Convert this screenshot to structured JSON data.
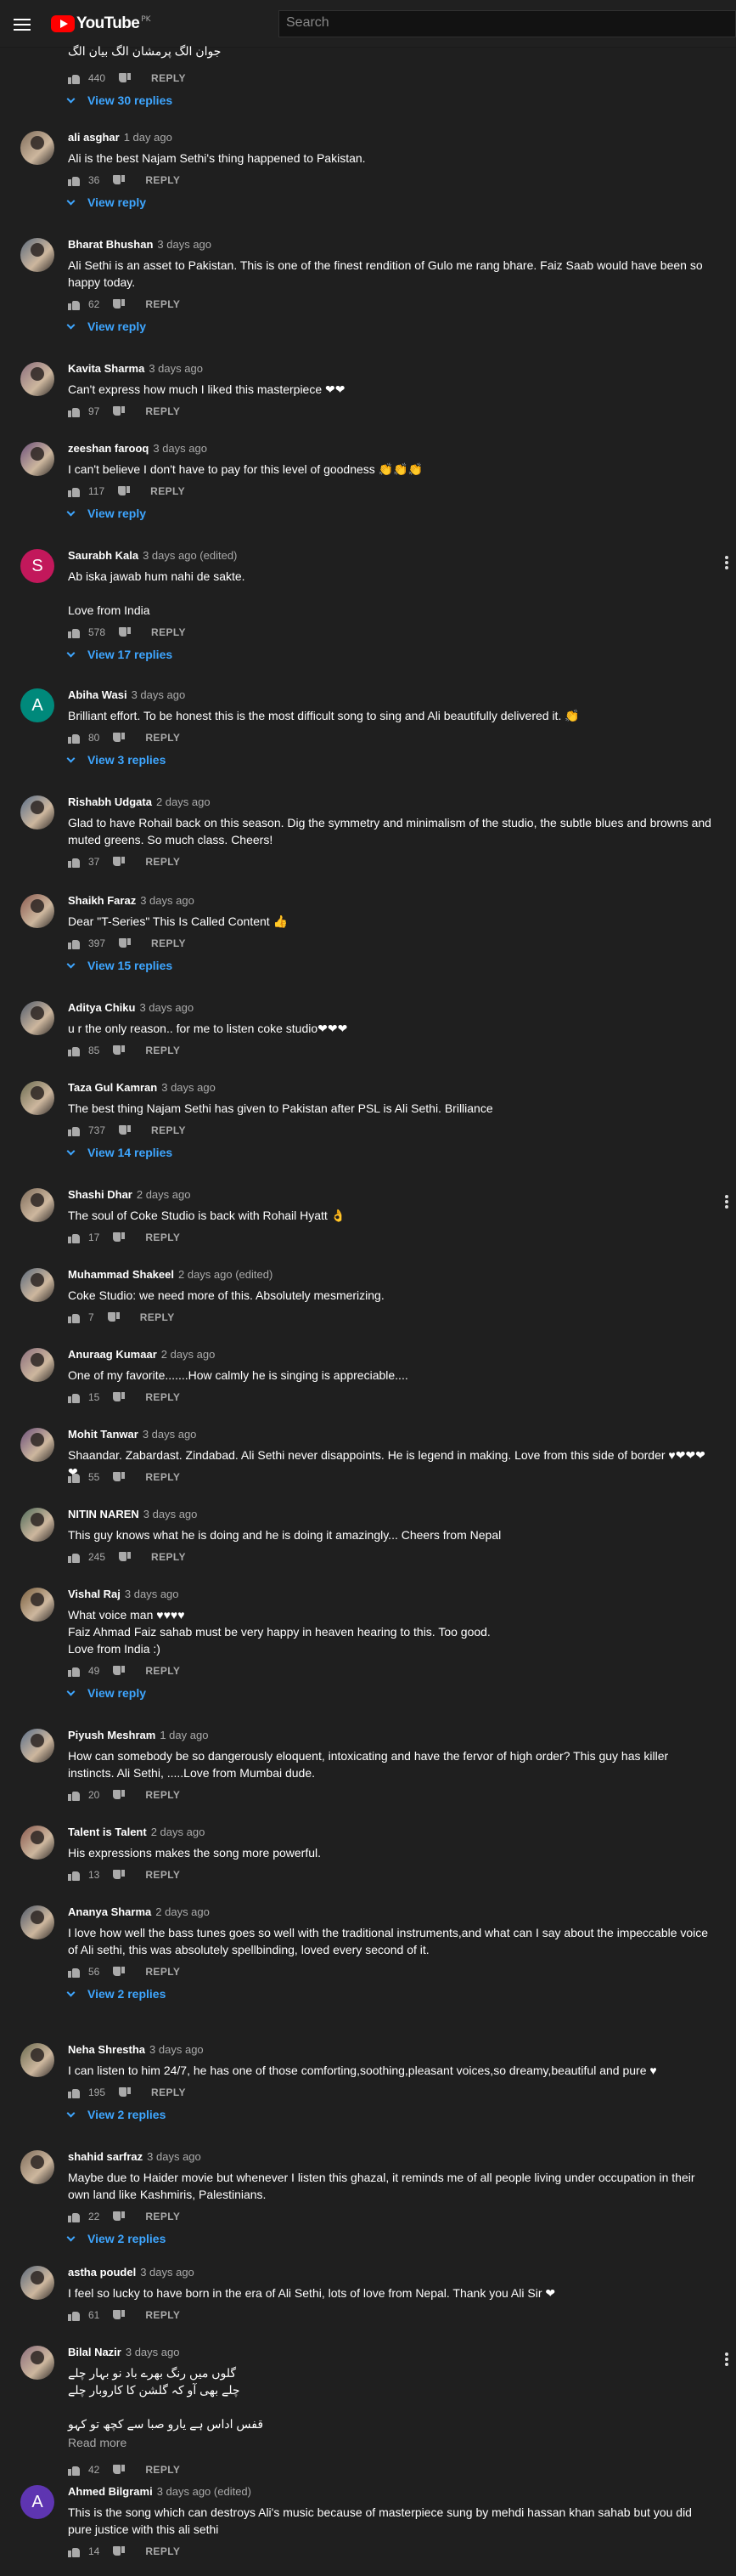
{
  "header": {
    "logo_text": "YouTube",
    "logo_region": "PK",
    "search_placeholder": "Search"
  },
  "top_partial": {
    "text": "جوان الگ پرمشان الگ بیان الگ",
    "likes": "440",
    "reply_label": "REPLY",
    "view_replies": "View 30 replies"
  },
  "comments": [
    {
      "name": "ali asghar",
      "date": "1 day ago",
      "text": "Ali is the best Najam Sethi's thing happened to Pakistan.",
      "likes": "36",
      "reply_label": "REPLY",
      "view_replies": "View reply"
    },
    {
      "name": "Bharat Bhushan",
      "date": "3 days ago",
      "text": "Ali Sethi is an asset to Pakistan. This is one of the finest rendition of Gulo me rang bhare. Faiz Saab would have been so happy today.",
      "likes": "62",
      "reply_label": "REPLY",
      "view_replies": "View reply"
    },
    {
      "name": "Kavita Sharma",
      "date": "3 days ago",
      "text": "Can't express how much I liked this masterpiece ❤❤",
      "likes": "97",
      "reply_label": "REPLY",
      "view_replies": ""
    },
    {
      "name": "zeeshan farooq",
      "date": "3 days ago",
      "text": "I can't believe I don't have to pay for this level of goodness 👏👏👏",
      "likes": "117",
      "reply_label": "REPLY",
      "view_replies": "View reply"
    },
    {
      "name": "Saurabh Kala",
      "date": "3 days ago (edited)",
      "text": "Ab iska jawab hum nahi de sakte.\n\nLove from India",
      "likes": "578",
      "reply_label": "REPLY",
      "view_replies": "View 17 replies",
      "avatar_letter": "S",
      "avatar_color": "#c2185b"
    },
    {
      "name": "Abiha Wasi",
      "date": "3 days ago",
      "text": "Brilliant effort. To be honest this is the most difficult song to sing and Ali beautifully delivered it. 👏",
      "likes": "80",
      "reply_label": "REPLY",
      "view_replies": "View 3 replies",
      "avatar_letter": "A",
      "avatar_color": "#00897b"
    },
    {
      "name": "Rishabh Udgata",
      "date": "2 days ago",
      "text": "Glad to have Rohail back on this season. Dig the symmetry and minimalism of the studio, the subtle blues and browns and muted greens. So much class. Cheers!",
      "likes": "37",
      "reply_label": "REPLY",
      "view_replies": ""
    },
    {
      "name": "Shaikh Faraz",
      "date": "3 days ago",
      "text": "Dear \"T-Series\" This Is Called Content 👍",
      "likes": "397",
      "reply_label": "REPLY",
      "view_replies": "View 15 replies"
    },
    {
      "name": "Aditya Chiku",
      "date": "3 days ago",
      "text": "u r the only reason..  for me to listen coke studio❤❤❤",
      "likes": "85",
      "reply_label": "REPLY",
      "view_replies": ""
    },
    {
      "name": "Taza Gul Kamran",
      "date": "3 days ago",
      "text": "The best thing Najam Sethi has given to Pakistan after PSL is Ali Sethi. Brilliance",
      "likes": "737",
      "reply_label": "REPLY",
      "view_replies": "View 14 replies"
    },
    {
      "name": "Shashi Dhar",
      "date": "2 days ago",
      "text": "The soul of Coke Studio is back with Rohail Hyatt 👌",
      "likes": "17",
      "reply_label": "REPLY",
      "view_replies": ""
    },
    {
      "name": "Muhammad Shakeel",
      "date": "2 days ago (edited)",
      "text": "Coke Studio: we need more of this. Absolutely mesmerizing.",
      "likes": "7",
      "reply_label": "REPLY",
      "view_replies": ""
    },
    {
      "name": "Anuraag Kumaar",
      "date": "2 days ago",
      "text": "One of my favorite.......How calmly he is singing is appreciable....",
      "likes": "15",
      "reply_label": "REPLY",
      "view_replies": ""
    },
    {
      "name": "Mohit Tanwar",
      "date": "3 days ago",
      "text": "Shaandar. Zabardast. Zindabad. Ali Sethi never disappoints. He is legend in making. Love from this side of border ♥❤❤❤❤",
      "likes": "55",
      "reply_label": "REPLY",
      "view_replies": ""
    },
    {
      "name": "NITIN NAREN",
      "date": "3 days ago",
      "text": "This guy knows what he is doing and he is doing it amazingly... Cheers from Nepal",
      "likes": "245",
      "reply_label": "REPLY",
      "view_replies": ""
    },
    {
      "name": "Vishal Raj",
      "date": "3 days ago",
      "text": "What voice man ♥♥♥♥\nFaiz Ahmad Faiz sahab must be very happy in heaven hearing to this. Too good.\nLove from India :)",
      "likes": "49",
      "reply_label": "REPLY",
      "view_replies": "View reply"
    },
    {
      "name": "Piyush Meshram",
      "date": "1 day ago",
      "text": "How can somebody be so dangerously eloquent, intoxicating and have the fervor of high order? This guy has killer instincts.  Ali Sethi, .....Love from Mumbai dude.",
      "likes": "20",
      "reply_label": "REPLY",
      "view_replies": ""
    },
    {
      "name": "Talent is Talent",
      "date": "2 days ago",
      "text": "His expressions makes the song more powerful.",
      "likes": "13",
      "reply_label": "REPLY",
      "view_replies": ""
    },
    {
      "name": "Ananya Sharma",
      "date": "2 days ago",
      "text": "I love how well the bass tunes goes so well with the traditional instruments,and what can I say  about the impeccable voice of Ali sethi, this was absolutely spellbinding, loved every second of it.",
      "likes": "56",
      "reply_label": "REPLY",
      "view_replies": "View 2 replies"
    },
    {
      "name": "Neha Shrestha",
      "date": "3 days ago",
      "text": "I can listen to him 24/7, he has one of those comforting,soothing,pleasant voices,so dreamy,beautiful and pure ♥",
      "likes": "195",
      "reply_label": "REPLY",
      "view_replies": "View 2 replies"
    },
    {
      "name": "shahid sarfraz",
      "date": "3 days ago",
      "text": "Maybe due to Haider movie but whenever I listen this ghazal, it reminds me of all people living under occupation in their own land like Kashmiris, Palestinians.",
      "likes": "22",
      "reply_label": "REPLY",
      "view_replies": "View 2 replies"
    },
    {
      "name": "astha poudel",
      "date": "3 days ago",
      "text": "I feel so lucky to have born in the era of Ali Sethi, lots of love from Nepal. Thank you Ali Sir ❤",
      "likes": "61",
      "reply_label": "REPLY",
      "view_replies": ""
    },
    {
      "name": "Bilal Nazir",
      "date": "3 days ago",
      "text": "گلوں میں رنگ بھرے باد نو بہار چلے\nچلے بھی آو کہ گلشن کا کاروبار چلے\n\nقفس اداس ہے یارو صبا سے کچھ تو کہو",
      "likes": "42",
      "reply_label": "REPLY",
      "view_replies": "",
      "read_more": "Read more"
    },
    {
      "name": "Ahmed Bilgrami",
      "date": "3 days ago (edited)",
      "text": "This is the song which can destroys Ali's music because of masterpiece sung by mehdi hassan khan sahab but you did pure justice with this ali sethi",
      "likes": "14",
      "reply_label": "REPLY",
      "view_replies": "",
      "avatar_letter": "A",
      "avatar_color": "#5e35b1"
    }
  ]
}
